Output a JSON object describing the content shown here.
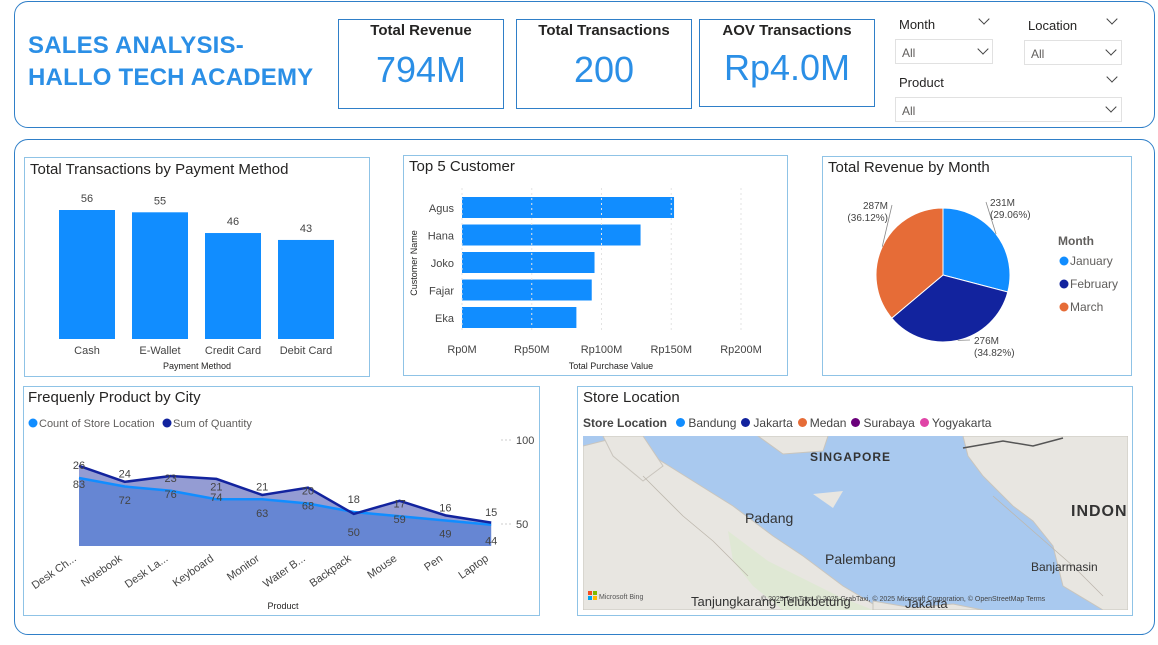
{
  "header": {
    "title_line1": "SALES ANALYSIS-",
    "title_line2": "HALLO TECH ACADEMY"
  },
  "kpis": [
    {
      "label": "Total Revenue",
      "value": "794M"
    },
    {
      "label": "Total Transactions",
      "value": "200"
    },
    {
      "label": "AOV Transactions",
      "value": "Rp4.0M"
    }
  ],
  "slicers": {
    "month": {
      "label": "Month",
      "value": "All"
    },
    "location": {
      "label": "Location",
      "value": "All"
    },
    "product": {
      "label": "Product",
      "value": "All"
    }
  },
  "colors": {
    "accent": "#118DFF",
    "navy": "#12239E",
    "orange": "#E66C37",
    "purple": "#6B007B",
    "pink": "#E044A7",
    "frame": "#2f7fc8"
  },
  "chart_data": [
    {
      "type": "bar",
      "title": "Total Transactions by Payment Method",
      "xlabel": "Payment Method",
      "categories": [
        "Cash",
        "E-Wallet",
        "Credit Card",
        "Debit Card"
      ],
      "values": [
        56,
        55,
        46,
        43
      ]
    },
    {
      "type": "bar",
      "orientation": "horizontal",
      "title": "Top 5 Customer",
      "xlabel": "Total Purchase Value",
      "ylabel": "Customer Name",
      "categories": [
        "Agus",
        "Hana",
        "Joko",
        "Fajar",
        "Eka"
      ],
      "values": [
        152,
        128,
        95,
        93,
        82
      ],
      "value_unit": "Rp M (estimated)",
      "xticks": [
        "Rp0M",
        "Rp50M",
        "Rp100M",
        "Rp150M",
        "Rp200M"
      ],
      "xlim": [
        0,
        200
      ]
    },
    {
      "type": "pie",
      "title": "Total Revenue by Month",
      "legend_title": "Month",
      "legend_position": "right",
      "slices": [
        {
          "name": "January",
          "value": 231,
          "label": "231M",
          "pct": "(29.06%)"
        },
        {
          "name": "February",
          "value": 276,
          "label": "276M",
          "pct": "(34.82%)"
        },
        {
          "name": "March",
          "value": 287,
          "label": "287M",
          "pct": "(36.12%)"
        }
      ]
    },
    {
      "type": "area",
      "title": "Frequenly Product by City",
      "xlabel": "Product",
      "legend_position": "top-left",
      "categories": [
        "Desk Ch...",
        "Notebook",
        "Desk La...",
        "Keyboard",
        "Monitor",
        "Water B...",
        "Backpack",
        "Mouse",
        "Pen",
        "Laptop"
      ],
      "series": [
        {
          "name": "Count of Store Location",
          "values": [
            26,
            24,
            23,
            21,
            21,
            20,
            18,
            17,
            16,
            15
          ]
        },
        {
          "name": "Sum of Quantity",
          "values": [
            83,
            72,
            76,
            74,
            63,
            68,
            50,
            59,
            49,
            44
          ]
        }
      ],
      "secondary_ticks": [
        "100",
        "50"
      ]
    }
  ],
  "map": {
    "title": "Store Location",
    "legend_title": "Store Location",
    "legend": [
      "Bandung",
      "Jakarta",
      "Medan",
      "Surabaya",
      "Yogyakarta"
    ],
    "places": [
      "SINGAPORE",
      "Padang",
      "Palembang",
      "INDON",
      "Banjarmasin",
      "Tanjungkarang-Telukbetung",
      "Jakarta"
    ],
    "attribution": "© 2025 TomTom, © 2025 GrabTaxi, © 2025 Microsoft Corporation, © OpenStreetMap Terms",
    "bing": "Microsoft Bing"
  }
}
